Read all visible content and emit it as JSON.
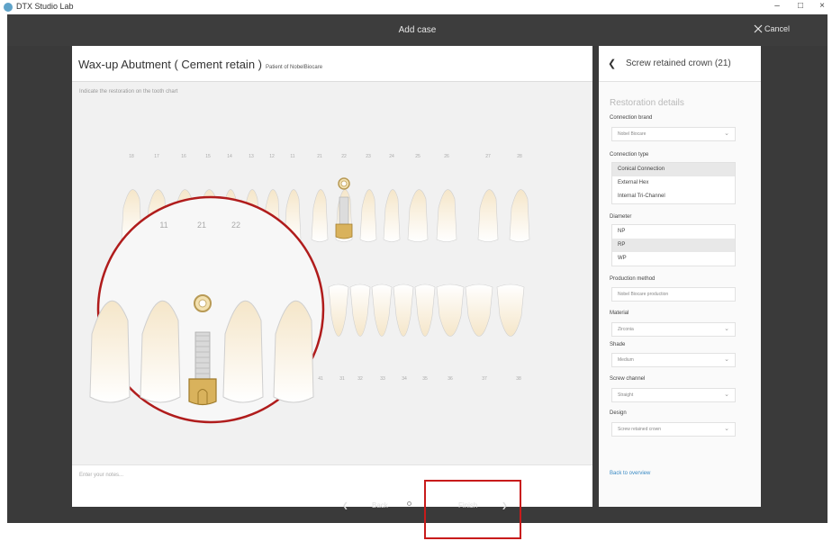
{
  "app": {
    "title": "DTX Studio Lab"
  },
  "window_controls": {
    "minimize": "–",
    "maximize": "□",
    "close": "×"
  },
  "header": {
    "title": "Add case",
    "cancel_label": "Cancel"
  },
  "case": {
    "title": "Wax-up Abutment ( Cement retain )",
    "subtitle": "Patient of NobelBiocare",
    "instruction": "Indicate the restoration on the tooth chart",
    "notes_placeholder": "Enter your notes..."
  },
  "tooth_chart": {
    "upper_numbers": [
      "18",
      "17",
      "16",
      "15",
      "14",
      "13",
      "12",
      "11",
      "21",
      "22",
      "23",
      "24",
      "25",
      "26",
      "27",
      "28"
    ],
    "lower_numbers": [
      "41",
      "31",
      "32",
      "33",
      "34",
      "35",
      "36",
      "37",
      "38"
    ],
    "zoom_numbers": [
      "11",
      "21",
      "22"
    ]
  },
  "restoration": {
    "back_icon": "chevron-left-icon",
    "title": "Screw retained crown (21)",
    "section_title": "Restoration details",
    "connection_brand": {
      "label": "Connection brand",
      "value": "Nobel Biocare"
    },
    "connection_type": {
      "label": "Connection type",
      "options": [
        "Conical Connection",
        "External Hex",
        "Internal Tri-Channel"
      ],
      "selected": "Conical Connection"
    },
    "diameter": {
      "label": "Diameter",
      "options": [
        "NP",
        "RP",
        "WP"
      ],
      "selected": "RP"
    },
    "production_method": {
      "label": "Production method",
      "value": "Nobel Biocare production"
    },
    "material": {
      "label": "Material",
      "value": "Zirconia"
    },
    "shade": {
      "label": "Shade",
      "value": "Medium"
    },
    "screw_channel": {
      "label": "Screw channel",
      "value": "Straight"
    },
    "design": {
      "label": "Design",
      "value": "Screw retained crown"
    },
    "back_link": "Back to overview"
  },
  "footer_nav": {
    "back_label": "Back",
    "finish_label": "Finish",
    "prev_icon": "chevron-left-icon",
    "next_icon": "chevron-right-icon"
  },
  "colors": {
    "dark_bg": "#3a3a3a",
    "highlight": "#c81b1b",
    "accent_link": "#3a8ac4",
    "implant_gold": "#d9b25c"
  }
}
